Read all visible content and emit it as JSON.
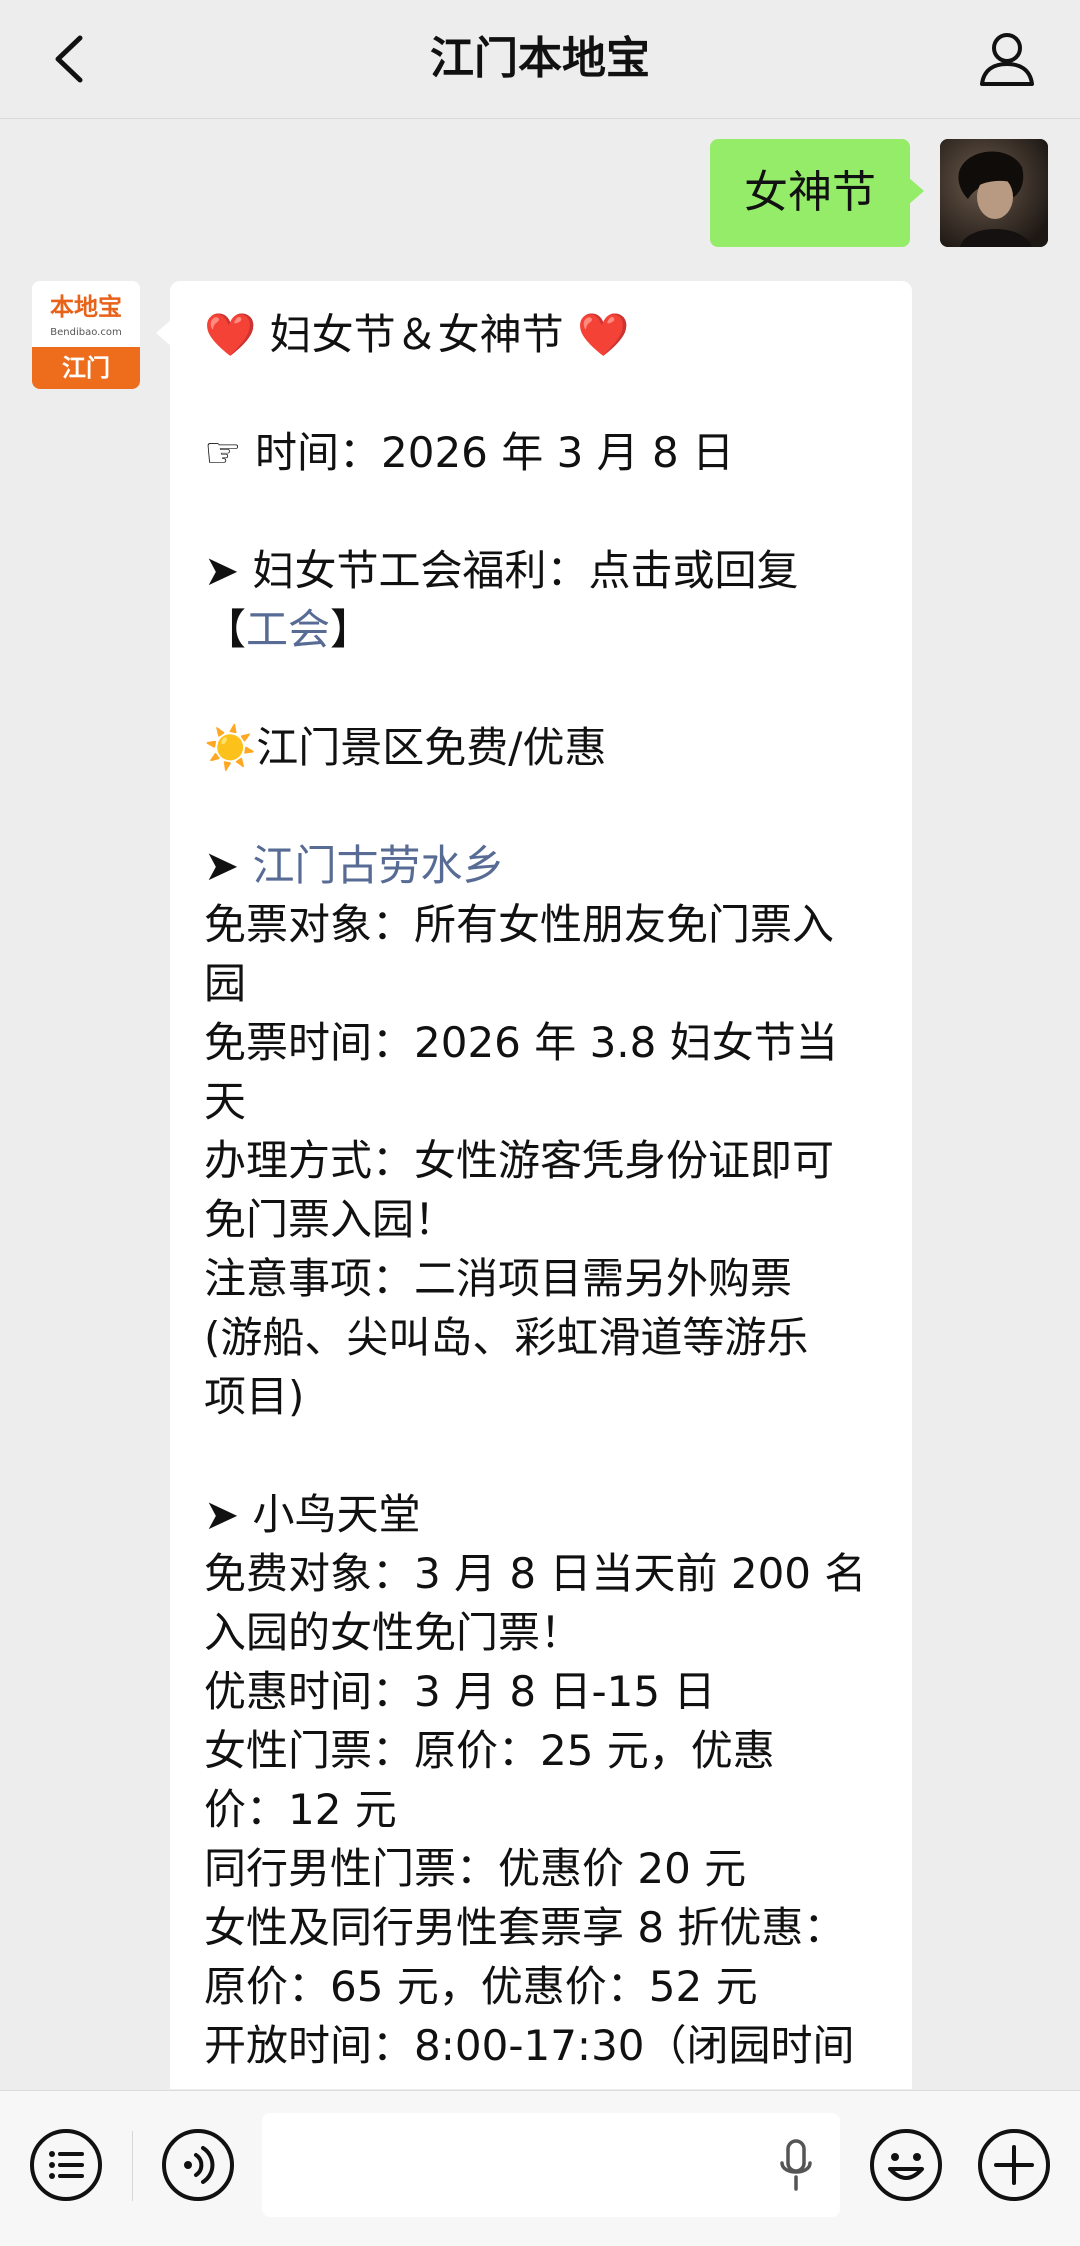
{
  "header": {
    "title": "江门本地宝"
  },
  "sent_message": {
    "text": "女神节"
  },
  "brand_avatar": {
    "name_cn": "本地宝",
    "name_en": "Bendibao.com",
    "city": "江门"
  },
  "article": {
    "lines": [
      {
        "prefix": "❤️",
        "text": " 妇女节＆女神节 ",
        "suffix": "❤️"
      },
      {
        "text": ""
      },
      {
        "text": "☞ 时间：2026 年 3 月 8 日"
      },
      {
        "text": ""
      },
      {
        "text": "➤ 妇女节工会福利：点击或回复"
      },
      {
        "bracket_open": "【",
        "link": "工会",
        "bracket_close": "】"
      },
      {
        "text": ""
      },
      {
        "text": "☀️江门景区免费/优惠"
      },
      {
        "text": ""
      },
      {
        "arrow": "➤ ",
        "link": "江门古劳水乡"
      },
      {
        "text": "免票对象：所有女性朋友免门票入"
      },
      {
        "text": "园"
      },
      {
        "text": "免票时间：2026 年 3.8 妇女节当"
      },
      {
        "text": "天"
      },
      {
        "text": "办理方式：女性游客凭身份证即可"
      },
      {
        "text": "免门票入园！"
      },
      {
        "text": "注意事项：二消项目需另外购票"
      },
      {
        "text": "(游船、尖叫岛、彩虹滑道等游乐"
      },
      {
        "text": "项目)"
      },
      {
        "text": ""
      },
      {
        "text": "➤ 小鸟天堂"
      },
      {
        "text": "免费对象：3 月 8 日当天前 200 名"
      },
      {
        "text": "入园的女性免门票！"
      },
      {
        "text": "优惠时间：3 月 8 日-15 日"
      },
      {
        "text": "女性门票：原价：25 元，优惠"
      },
      {
        "text": "价：12 元"
      },
      {
        "text": "同行男性门票：优惠价 20 元"
      },
      {
        "text": "女性及同行男性套票享 8 折优惠："
      },
      {
        "text": "原价：65 元，优惠价：52 元"
      },
      {
        "text": "开放时间：8:00-17:30（闭园时间"
      }
    ]
  },
  "colors": {
    "sent_bubble": "#95ec69",
    "link": "#576b95",
    "brand_orange": "#ee6d1c"
  },
  "icons": {
    "back": "chevron-left-icon",
    "profile": "user-icon",
    "menu": "list-icon",
    "voice": "voice-icon",
    "mic": "microphone-icon",
    "emoji": "smiley-icon",
    "plus": "plus-icon"
  }
}
